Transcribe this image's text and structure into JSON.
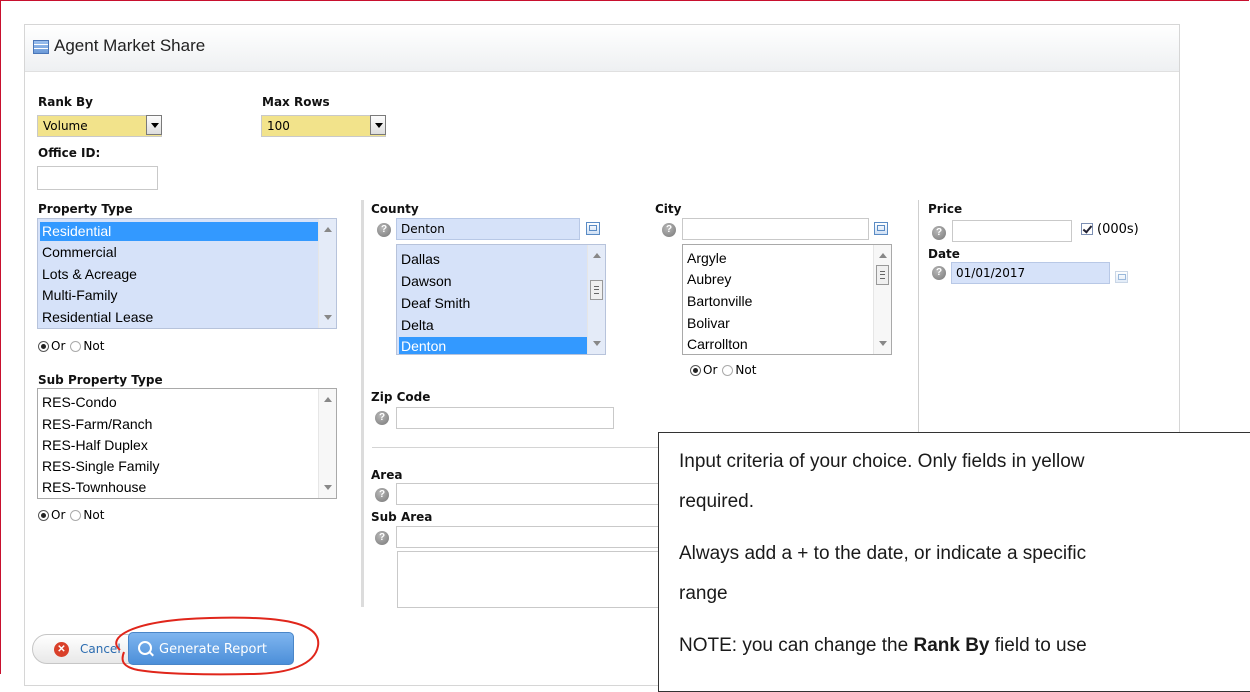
{
  "header": {
    "title": "Agent Market Share"
  },
  "rank_by": {
    "label": "Rank By",
    "value": "Volume"
  },
  "max_rows": {
    "label": "Max Rows",
    "value": "100"
  },
  "office_id": {
    "label": "Office ID:",
    "value": ""
  },
  "property_type": {
    "label": "Property Type",
    "items": [
      "Residential",
      "Commercial",
      "Lots & Acreage",
      "Multi-Family",
      "Residential Lease"
    ],
    "selected": "Residential",
    "or_label": "Or",
    "not_label": "Not"
  },
  "sub_property_type": {
    "label": "Sub Property Type",
    "items": [
      "RES-Condo",
      "RES-Farm/Ranch",
      "RES-Half Duplex",
      "RES-Single Family",
      "RES-Townhouse"
    ],
    "or_label": "Or",
    "not_label": "Not"
  },
  "county": {
    "label": "County",
    "input_value": "Denton",
    "items": [
      "Dallas",
      "Dawson",
      "Deaf Smith",
      "Delta",
      "Denton"
    ],
    "selected": "Denton"
  },
  "city": {
    "label": "City",
    "input_value": "",
    "items": [
      "Argyle",
      "Aubrey",
      "Bartonville",
      "Bolivar",
      "Carrollton"
    ],
    "or_label": "Or",
    "not_label": "Not"
  },
  "price": {
    "label": "Price",
    "value": "",
    "unit_label": "(000s)",
    "unit_checked": true
  },
  "date": {
    "label": "Date",
    "value": "01/01/2017"
  },
  "zip_code": {
    "label": "Zip Code",
    "value": ""
  },
  "area": {
    "label": "Area",
    "value": ""
  },
  "sub_area": {
    "label": "Sub Area",
    "value": ""
  },
  "buttons": {
    "cancel": "Cancel",
    "generate": "Generate Report"
  },
  "note": {
    "line1": "Input criteria of your choice.  Only fields in yellow",
    "line2": "required.",
    "line3": "Always add a + to the date, or indicate a specific",
    "line4": "range",
    "line5_pre": "NOTE: you can change the ",
    "line5_bold": "Rank By",
    "line5_post": " field to use"
  },
  "colors": {
    "required_field": "#f2e38b",
    "selected_row": "#3399ff",
    "annotation": "#e0261b"
  }
}
